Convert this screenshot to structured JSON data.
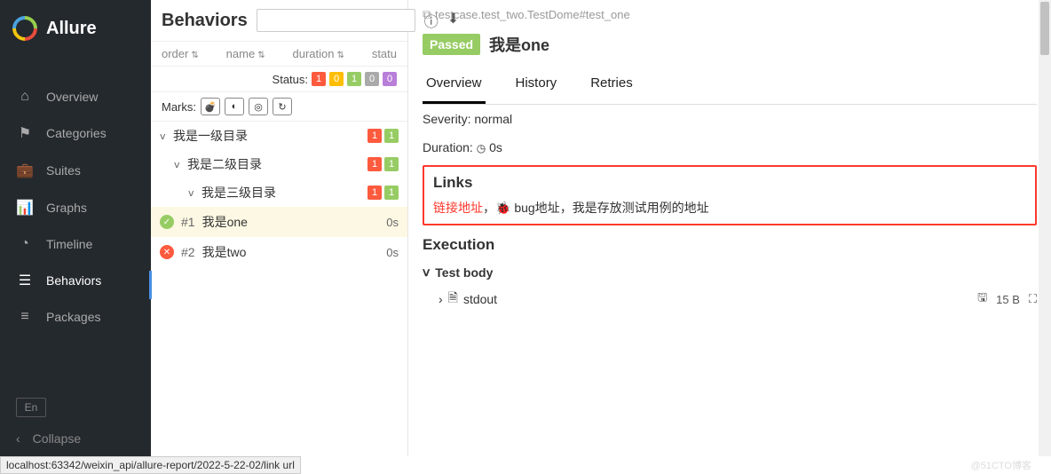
{
  "brand": "Allure",
  "nav": {
    "overview": "Overview",
    "categories": "Categories",
    "suites": "Suites",
    "graphs": "Graphs",
    "timeline": "Timeline",
    "behaviors": "Behaviors",
    "packages": "Packages"
  },
  "sidebar": {
    "lang": "En",
    "collapse": "Collapse"
  },
  "mid": {
    "title": "Behaviors",
    "cols": {
      "order": "order",
      "name": "name",
      "duration": "duration",
      "status": "statu"
    },
    "status_label": "Status:",
    "status_counts": {
      "red": "1",
      "yellow": "0",
      "green": "1",
      "grey": "0",
      "purple": "0"
    },
    "marks_label": "Marks:",
    "tree": {
      "l1": {
        "label": "我是一级目录",
        "badges": [
          "1",
          "1"
        ]
      },
      "l2": {
        "label": "我是二级目录",
        "badges": [
          "1",
          "1"
        ]
      },
      "l3": {
        "label": "我是三级目录",
        "badges": [
          "1",
          "1"
        ]
      },
      "leaf1": {
        "num": "#1",
        "name": "我是one",
        "dur": "0s"
      },
      "leaf2": {
        "num": "#2",
        "name": "我是two",
        "dur": "0s"
      }
    }
  },
  "right": {
    "crumb": "testcase.test_two.TestDome#test_one",
    "status_badge": "Passed",
    "title": "我是one",
    "tabs": {
      "overview": "Overview",
      "history": "History",
      "retries": "Retries"
    },
    "severity_label": "Severity:",
    "severity_value": "normal",
    "duration_label": "Duration:",
    "duration_value": "0s",
    "links_heading": "Links",
    "links": {
      "link_url": "链接地址",
      "sep1": "，",
      "bug_url": "bug地址",
      "sep2": "，",
      "testcase_url": "我是存放测试用例的地址"
    },
    "execution_heading": "Execution",
    "test_body": "Test body",
    "stdout": "stdout",
    "stdout_size": "15 B"
  },
  "statusbar": "localhost:63342/weixin_api/allure-report/2022-5-22-02/link url",
  "watermark": "@51CTO博客"
}
